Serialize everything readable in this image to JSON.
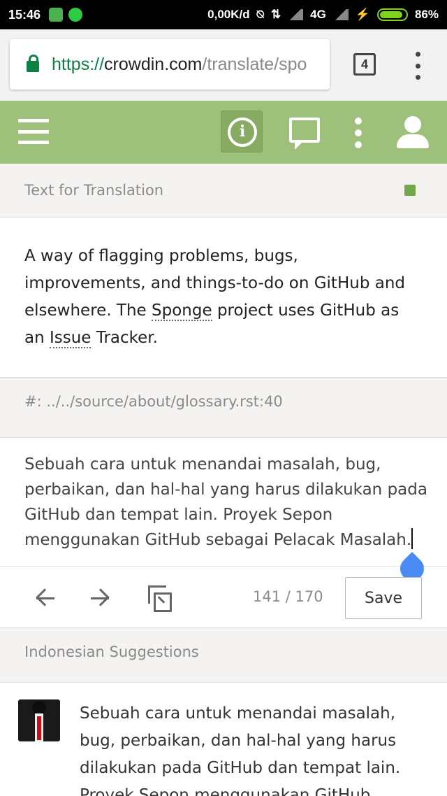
{
  "status_bar": {
    "time": "15:46",
    "network_speed": "0,00K/d",
    "network_type": "4G",
    "battery_percent": "86%",
    "icons": [
      "battery-app-icon",
      "whatsapp-icon",
      "mute-icon",
      "data-icon",
      "signal-icon",
      "charging-icon",
      "battery-icon"
    ]
  },
  "browser": {
    "url_scheme": "https://",
    "url_host": "crowdin.com",
    "url_path": "/translate/spo",
    "tab_count": "4"
  },
  "app_header": {
    "icons": [
      "menu-icon",
      "info-icon",
      "comments-icon",
      "more-icon",
      "user-icon"
    ],
    "info_glyph": "i",
    "accent_color": "#9dc07a"
  },
  "source_section": {
    "heading": "Text for Translation",
    "text_parts": {
      "p1": "A way of flagging problems, bugs, improvements, and things-to-do on GitHub and elsewhere. The ",
      "term1": "Sponge",
      "p2": " project uses GitHub as an ",
      "term2": "Issue",
      "p3": " Tracker."
    }
  },
  "context": {
    "reference": "#: ../../source/about/glossary.rst:40"
  },
  "translation": {
    "value": "Sebuah cara untuk menandai masalah, bug, perbaikan, dan hal-hal yang harus dilakukan pada GitHub dan tempat lain. Proyek Sepon menggunakan GitHub sebagai Pelacak Masalah."
  },
  "toolbar": {
    "counter": "141 / 170",
    "save_label": "Save"
  },
  "suggestions": {
    "heading": "Indonesian Suggestions",
    "items": [
      {
        "text": "Sebuah cara untuk menandai masalah, bug, perbaikan, dan hal-hal yang harus dilakukan pada GitHub dan tempat lain. Proyek Sepon menggunakan GitHub"
      }
    ]
  }
}
